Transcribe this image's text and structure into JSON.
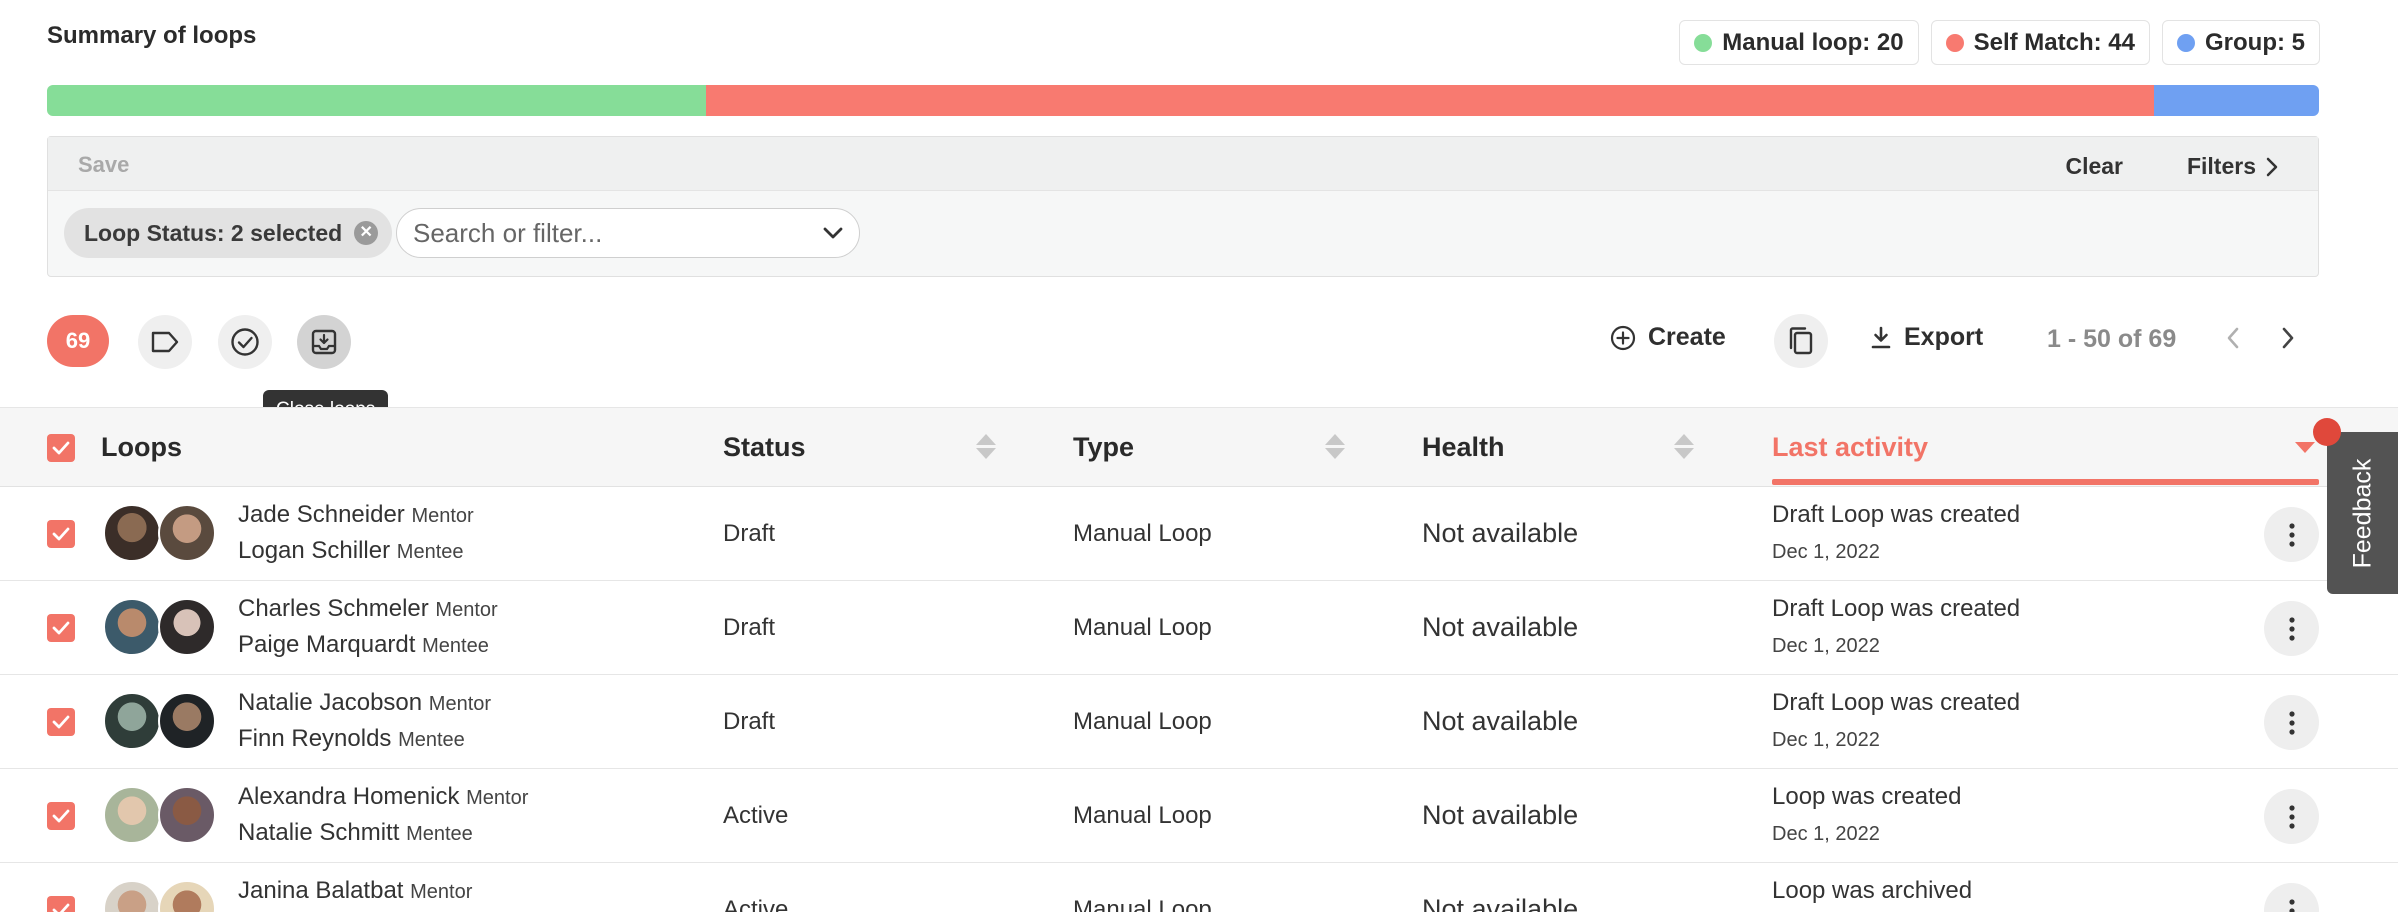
{
  "summary": {
    "title": "Summary of loops",
    "legend": [
      {
        "label": "Manual loop: 20",
        "color": "#86dd98"
      },
      {
        "label": "Self Match: 44",
        "color": "#f87a70"
      },
      {
        "label": "Group: 5",
        "color": "#6fa0f2"
      }
    ],
    "segments": [
      {
        "name": "Manual loop",
        "value": 20,
        "color": "#86dd98"
      },
      {
        "name": "Self Match",
        "value": 44,
        "color": "#f87a70"
      },
      {
        "name": "Group",
        "value": 5,
        "color": "#6fa0f2"
      }
    ]
  },
  "filters": {
    "save_label": "Save",
    "clear_label": "Clear",
    "filters_label": "Filters",
    "chip_label": "Loop Status: 2 selected",
    "search_placeholder": "Search or filter..."
  },
  "toolbar": {
    "count": "69",
    "tooltip": "Close loops",
    "create_label": "Create",
    "export_label": "Export",
    "pagination": "1 - 50 of 69"
  },
  "table": {
    "columns": {
      "loops": "Loops",
      "status": "Status",
      "type": "Type",
      "health": "Health",
      "last_activity": "Last activity"
    },
    "rows": [
      {
        "mentor": "Jade Schneider",
        "mentor_role": "Mentor",
        "mentee": "Logan Schiller",
        "mentee_role": "Mentee",
        "status": "Draft",
        "type": "Manual Loop",
        "health": "Not available",
        "activity": "Draft Loop was created",
        "date": "Dec 1, 2022"
      },
      {
        "mentor": "Charles Schmeler",
        "mentor_role": "Mentor",
        "mentee": "Paige Marquardt",
        "mentee_role": "Mentee",
        "status": "Draft",
        "type": "Manual Loop",
        "health": "Not available",
        "activity": "Draft Loop was created",
        "date": "Dec 1, 2022"
      },
      {
        "mentor": "Natalie Jacobson",
        "mentor_role": "Mentor",
        "mentee": "Finn Reynolds",
        "mentee_role": "Mentee",
        "status": "Draft",
        "type": "Manual Loop",
        "health": "Not available",
        "activity": "Draft Loop was created",
        "date": "Dec 1, 2022"
      },
      {
        "mentor": "Alexandra Homenick",
        "mentor_role": "Mentor",
        "mentee": "Natalie Schmitt",
        "mentee_role": "Mentee",
        "status": "Active",
        "type": "Manual Loop",
        "health": "Not available",
        "activity": "Loop was created",
        "date": "Dec 1, 2022"
      },
      {
        "mentor": "Janina Balatbat",
        "mentor_role": "Mentor",
        "mentee": "",
        "mentee_role": "",
        "status": "Active",
        "type": "Manual Loop",
        "health": "Not available",
        "activity": "Loop was archived",
        "date": ""
      }
    ]
  },
  "feedback_label": "Feedback"
}
